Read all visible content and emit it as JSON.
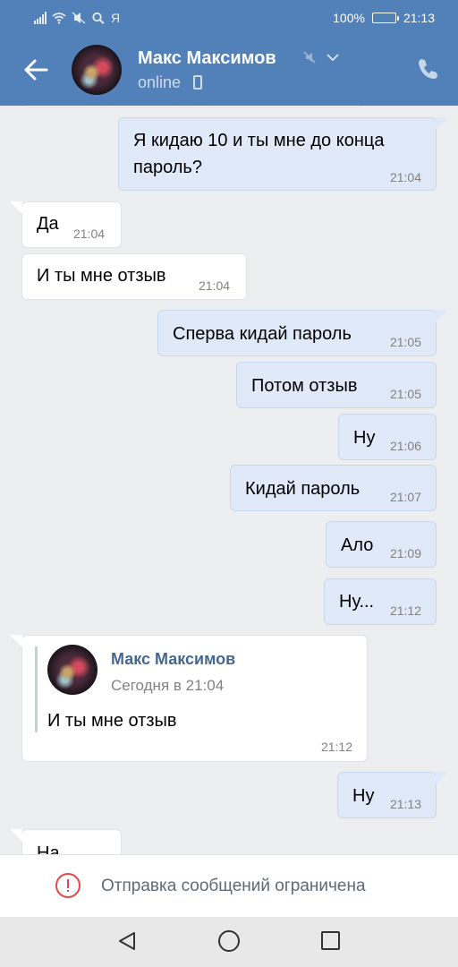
{
  "status_bar": {
    "battery": "100%",
    "time": "21:13",
    "carrier_glyph": "Я"
  },
  "header": {
    "name": "Макс Максимов",
    "status": "online",
    "icons": [
      "back-arrow-icon",
      "avatar",
      "mute-icon",
      "chevron-down-icon",
      "mobile-icon",
      "phone-call-icon"
    ]
  },
  "messages": [
    {
      "dir": "out",
      "lines": [
        "Я кидаю 10 и ты мне до конца",
        "пароль?"
      ],
      "time": "21:04"
    },
    {
      "dir": "in",
      "text": "Да",
      "time": "21:04"
    },
    {
      "dir": "in",
      "text": "И ты мне отзыв",
      "time": "21:04"
    },
    {
      "dir": "out",
      "text": "Сперва кидай пароль",
      "time": "21:05"
    },
    {
      "dir": "out",
      "text": "Потом отзыв",
      "time": "21:05"
    },
    {
      "dir": "out",
      "text": "Ну",
      "time": "21:06"
    },
    {
      "dir": "out",
      "text": "Кидай пароль",
      "time": "21:07"
    },
    {
      "dir": "out",
      "text": "Ало",
      "time": "21:09"
    },
    {
      "dir": "out",
      "text": "Ну...",
      "time": "21:12"
    },
    {
      "dir": "in",
      "forwarded": {
        "name": "Макс Максимов",
        "date": "Сегодня в 21:04",
        "text": "И ты мне отзыв"
      },
      "time": "21:12"
    },
    {
      "dir": "out",
      "text": "Ну",
      "time": "21:13"
    },
    {
      "dir": "in",
      "text": "На",
      "time": ""
    }
  ],
  "restriction": {
    "text": "Отправка сообщений ограничена",
    "icon": "exclamation-circle-icon",
    "color": "#e64646"
  },
  "colors": {
    "header": "#5181b8",
    "outgoing": "#dfe9f7",
    "incoming": "#ffffff",
    "background": "#edeef0"
  },
  "navigation": {
    "icons": [
      "nav-back-icon",
      "nav-home-icon",
      "nav-recent-icon"
    ]
  }
}
